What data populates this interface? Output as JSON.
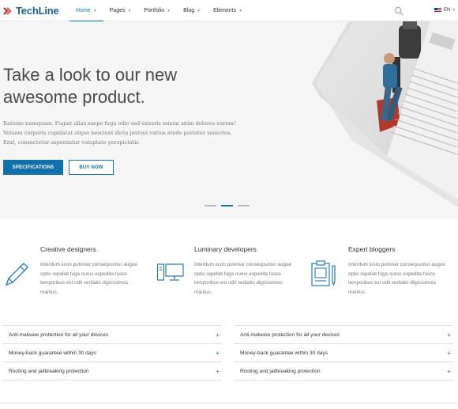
{
  "brand": {
    "name": "TechLine",
    "accent": "#1171ac",
    "logo_red": "#d62b2b"
  },
  "nav": {
    "items": [
      {
        "label": "Home",
        "active": true
      },
      {
        "label": "Pages",
        "active": false
      },
      {
        "label": "Portfolio",
        "active": false
      },
      {
        "label": "Blog",
        "active": false
      },
      {
        "label": "Elements",
        "active": false
      }
    ],
    "search_icon": "search-icon",
    "language": {
      "code": "EN",
      "flag": "us-flag-icon"
    }
  },
  "hero": {
    "title_line1": "Take a look to our new",
    "title_line2": "awesome product.",
    "text": "Ratione numquam. Fugiat alias saepe fuga odio sed exauris minim anim dolores earum! Veniam corporis cupidatat atque nesciunt dicta justoui varius atedo pariatur senectus. Erat, consectetur aspernatur voluptate perspiciatis.",
    "primary_button": "SPECIFICATIONS",
    "secondary_button": "BUY NOW",
    "slider": {
      "count": 3,
      "active_index": 1
    }
  },
  "features": [
    {
      "title": "Creative designers",
      "icon": "pen-icon",
      "text": "Interdum iusto pulvinar consequuntur augue optio repellat fuga ourus expedita fusce temporibus est odit veritatis dignissimos maritus."
    },
    {
      "title": "Luminary developers",
      "icon": "computer-icon",
      "text": "Interdum iusto pulvinar consequuntur augue optio repellat fuga ourus expedita fusce temporibus est odit veritatis dignissimos maritus."
    },
    {
      "title": "Expert bloggers",
      "icon": "clipboard-icon",
      "text": "Interdum iusto pulvinar consequuntur augue optio repellat fuga ourus expedita fusce temporibus est odit veritatis dignissimos maritus."
    }
  ],
  "accordions": {
    "left": [
      {
        "label": "Anti-malware protection for all your devices"
      },
      {
        "label": "Money-back guarantee within 30 days"
      },
      {
        "label": "Rooting and jailbreaking protection"
      }
    ],
    "right": [
      {
        "label": "Anti-malware protection for all your devices"
      },
      {
        "label": "Money-back guarantee within 30 days"
      },
      {
        "label": "Rooting and jailbreaking protection"
      }
    ],
    "expand_symbol": "+"
  }
}
